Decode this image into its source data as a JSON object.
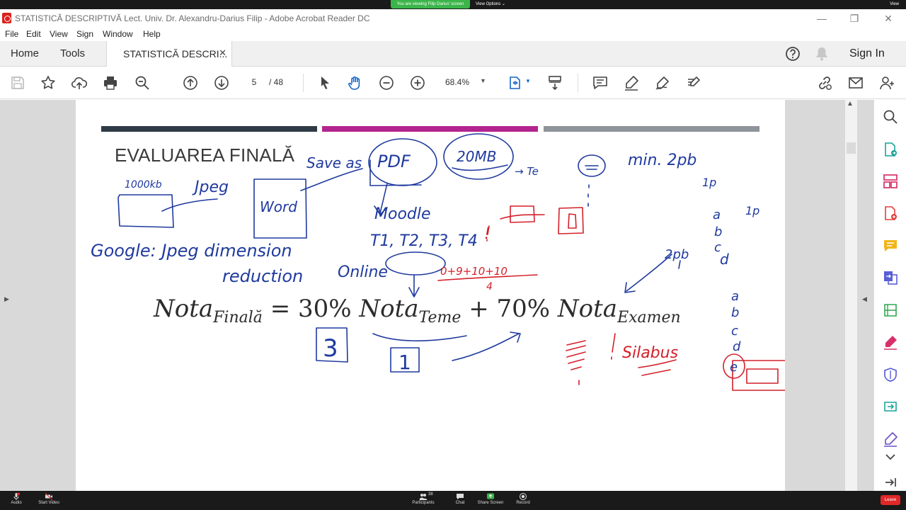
{
  "zoom_top": {
    "share_banner": "You are viewing Filip Darius' screen",
    "view_options": "View Options",
    "view_label": "View"
  },
  "window": {
    "title": "STATISTICĂ DESCRIPTIVĂ Lect. Univ. Dr. Alexandru-Darius Filip - Adobe Acrobat Reader DC",
    "minimize": "—",
    "restore": "❐",
    "close": "✕"
  },
  "menu": [
    "File",
    "Edit",
    "View",
    "Sign",
    "Window",
    "Help"
  ],
  "tabs": {
    "home": "Home",
    "tools": "Tools",
    "document": "STATISTICĂ DESCRI...",
    "document_close": "✕",
    "sign_in": "Sign In"
  },
  "toolbar": {
    "current_page": "5",
    "total_pages": "/  48",
    "zoom": "68.4%",
    "zoom_caret": "▼"
  },
  "slide": {
    "title": "EVALUAREA FINALĂ",
    "formula": {
      "nota1": "Nota",
      "sub1": "Finală",
      "eq": " = 30% ",
      "nota2": "Nota",
      "sub2": "Teme",
      "plus": " + 70% ",
      "nota3": "Nota",
      "sub3": "Examen"
    },
    "stripe_colors": [
      "#2e3a45",
      "#b3248f",
      "#8f949a"
    ]
  },
  "annotations": {
    "blue": {
      "save_as": "Save as",
      "pdf": "PDF",
      "size_20mb": "20MB",
      "teme": "→ Te",
      "min_2pb": "min. 2pb",
      "one_p_a": "1p",
      "size_1000kb": "1000kb",
      "jpeg": "Jpeg",
      "word": "Word",
      "moodle": "Moodle",
      "t_list": "T1, T2, T3, T4",
      "google": "Google: Jpeg dimension",
      "reduction": "reduction",
      "online": "Online",
      "two_pb": "2pb",
      "letters_top": [
        "a",
        "b",
        "c",
        "d"
      ],
      "one_p_b": "1p",
      "letters_bottom": [
        "a",
        "b",
        "c",
        "d",
        "e"
      ],
      "box_3": "3",
      "box_1": "1"
    },
    "red": {
      "sum": "0+9+10+10",
      "denominator": "4",
      "silabus": "Silabus",
      "exclaim": "!"
    }
  },
  "zoom_bar": {
    "audio": "Audio",
    "start_video": "Start Video",
    "participants": "Participants",
    "participants_count": "38",
    "chat": "Chat",
    "share_screen": "Share Screen",
    "record": "Record",
    "leave": "Leave"
  },
  "colors": {
    "ink_blue": "#1f3a9e",
    "ink_red": "#d4202a",
    "acrobat_red": "#d9221c",
    "share_green": "#3bb54a"
  }
}
